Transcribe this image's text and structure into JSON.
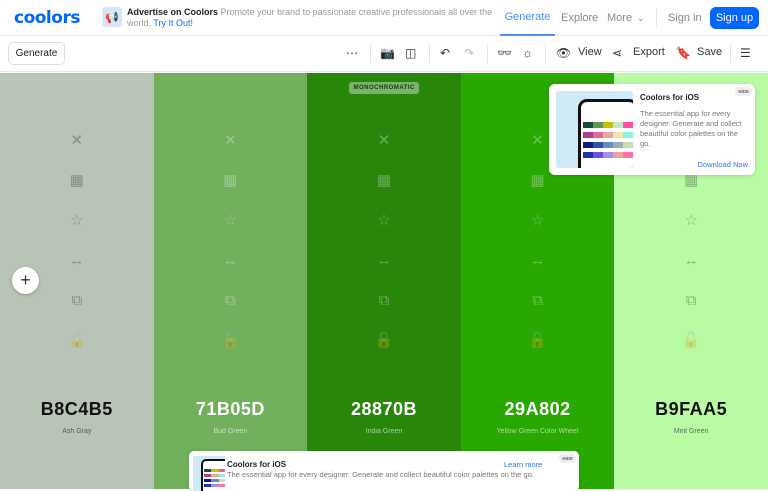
{
  "header": {
    "logo": "coolors",
    "ad_title": "Advertise on Coolors",
    "ad_text": "Promote your brand to passionate creative professionals all over the world.",
    "ad_link": "Try It Out!",
    "nav": [
      "Generate",
      "Explore",
      "More"
    ],
    "sign_in": "Sign in",
    "sign_up": "Sign up"
  },
  "toolbar": {
    "generate": "Generate",
    "view": "View",
    "export": "Export",
    "save": "Save"
  },
  "palette": [
    {
      "hex": "B8C4B5",
      "name": "Ash Gray",
      "color": "#B8C4B5",
      "text": "#111111"
    },
    {
      "hex": "71B05D",
      "name": "Bud Green",
      "color": "#71B05D",
      "text": "#ffffff"
    },
    {
      "hex": "28870B",
      "name": "India Green",
      "color": "#28870B",
      "text": "#ffffff",
      "badge": "MONOCHROMATIC"
    },
    {
      "hex": "29A802",
      "name": "Yellow Green Color Wheel",
      "color": "#29A802",
      "text": "#ffffff"
    },
    {
      "hex": "B9FAA5",
      "name": "Mint Green",
      "color": "#B9FAA5",
      "text": "#111111"
    }
  ],
  "ios_card": {
    "title": "Coolors for iOS",
    "desc": "The essential app for every designer. Generate and collect beautiful color palettes on the go.",
    "link": "Download Now",
    "hide": "HIDE"
  },
  "bottom_banner": {
    "title": "Coolors for iOS",
    "desc": "The essential app for every designer. Generate and collect beautiful color palettes on the go.",
    "link": "Learn more",
    "hide": "HIDE"
  }
}
